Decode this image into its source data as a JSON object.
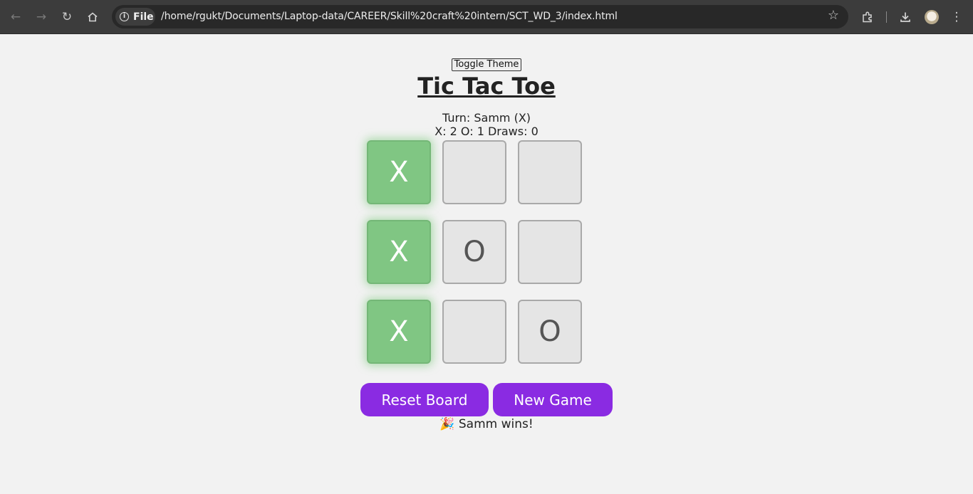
{
  "browser": {
    "chip_label": "File",
    "url": "/home/rgukt/Documents/Laptop-data/CAREER/Skill%20craft%20intern/SCT_WD_3/index.html",
    "icons": [
      "back-icon",
      "forward-icon",
      "reload-icon",
      "home-icon",
      "info-icon",
      "star-icon",
      "extensions-icon",
      "download-icon",
      "avatar",
      "more-icon"
    ]
  },
  "page": {
    "toggle_label": "Toggle Theme",
    "title": "Tic Tac Toe",
    "turn": "Turn: Samm (X)",
    "score": "X: 2 O: 1 Draws: 0",
    "board": [
      "X",
      "",
      "",
      "X",
      "O",
      "",
      "X",
      "",
      "O"
    ],
    "winning_cells": [
      0,
      3,
      6
    ],
    "reset_label": "Reset Board",
    "new_game_label": "New Game",
    "result": "🎉 Samm wins!"
  },
  "colors": {
    "button": "#8a2be2",
    "win_cell": "#80c683",
    "cell": "#e5e5e5",
    "background": "#f2f2f2"
  }
}
